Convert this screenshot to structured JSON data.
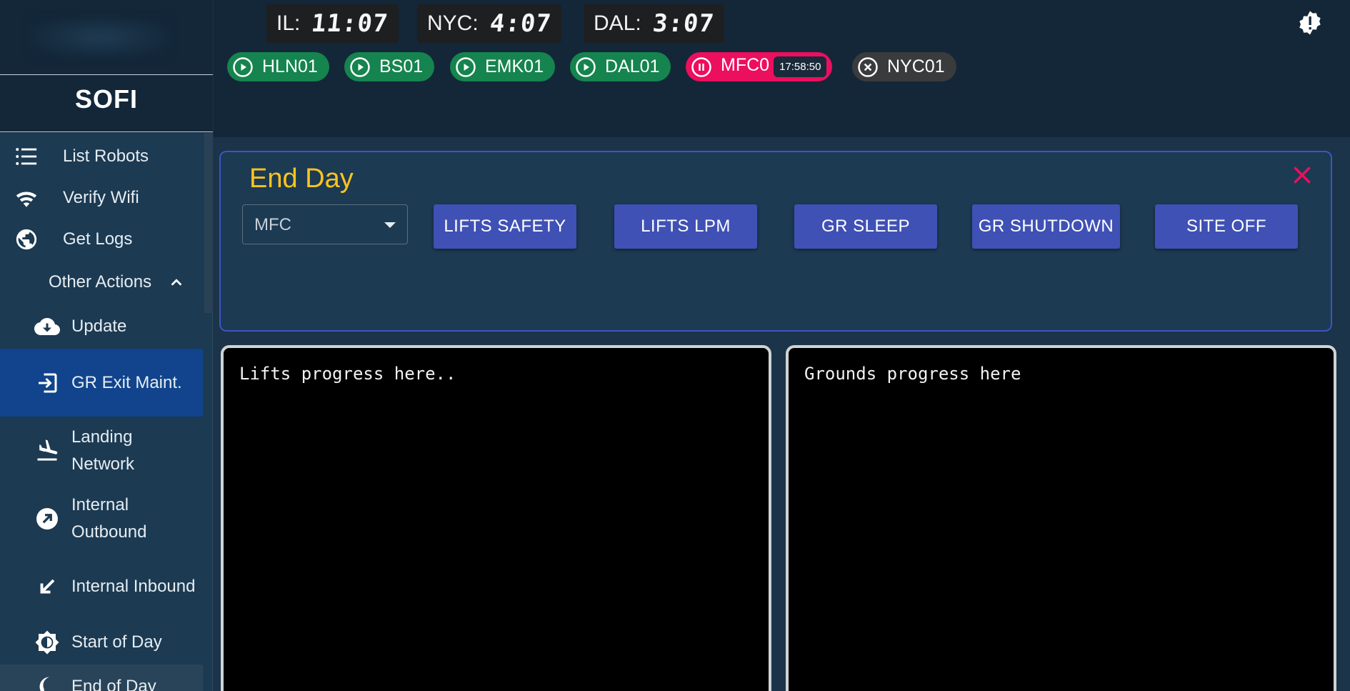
{
  "sidebar": {
    "brand": "SOFI",
    "items": [
      {
        "label": "List Robots",
        "icon": "list-icon"
      },
      {
        "label": "Verify Wifi",
        "icon": "wifi-check-icon"
      },
      {
        "label": "Get Logs",
        "icon": "globe-icon"
      }
    ],
    "other_actions": {
      "label": "Other Actions",
      "expanded": true,
      "items": [
        {
          "label": "Update",
          "icon": "cloud-download-icon"
        },
        {
          "label": "GR Exit Maint.",
          "icon": "exit-icon",
          "active": true
        },
        {
          "label": "Landing Network",
          "icon": "plane-landing-icon"
        },
        {
          "label": "Internal Outbound",
          "icon": "arrow-up-right-icon"
        },
        {
          "label": "Internal Inbound",
          "icon": "arrow-down-left-icon"
        },
        {
          "label": "Start of Day",
          "icon": "brightness-icon"
        },
        {
          "label": "End of Day",
          "icon": "moon-icon"
        }
      ]
    }
  },
  "header": {
    "clocks": [
      {
        "city": "IL:",
        "time": "11:07"
      },
      {
        "city": "NYC:",
        "time": "4:07"
      },
      {
        "city": "DAL:",
        "time": "3:07"
      }
    ],
    "sites": [
      {
        "name": "HLN01",
        "status": "running"
      },
      {
        "name": "BS01",
        "status": "running"
      },
      {
        "name": "EMK01",
        "status": "running"
      },
      {
        "name": "DAL01",
        "status": "running"
      },
      {
        "name": "MFC0",
        "status": "paused",
        "timer": "17:58:50"
      },
      {
        "name": "NYC01",
        "status": "stopped"
      }
    ]
  },
  "panel": {
    "title": "End Day",
    "site_select": {
      "value": "MFC"
    },
    "buttons": [
      "LIFTS SAFETY",
      "LIFTS LPM",
      "GR SLEEP",
      "GR SHUTDOWN",
      "SITE OFF"
    ]
  },
  "consoles": {
    "lifts": "Lifts progress here..",
    "grounds": "Grounds progress here"
  },
  "colors": {
    "page_bg": "#1b3449",
    "header_bg": "#132739",
    "accent_blue": "#3f51b5",
    "title_yellow": "#ffc31f",
    "running_green": "#15844e",
    "paused_red": "#ec0f5e",
    "stopped_grey": "#3a3b3d",
    "active_nav": "#11448c"
  }
}
